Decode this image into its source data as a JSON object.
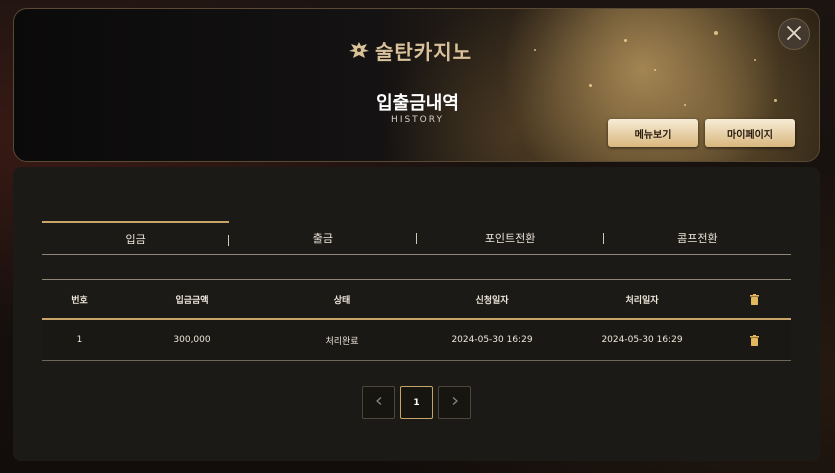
{
  "banner": {
    "logo_text": "술탄카지노",
    "title": "입출금내역",
    "subtitle": "HISTORY",
    "menu_button": "메뉴보기",
    "mypage_button": "마이페이지"
  },
  "icons": {
    "logo": "eagle-emblem-icon",
    "close": "close-icon",
    "delete": "trash-icon",
    "prev": "chevron-left-icon",
    "next": "chevron-right-icon"
  },
  "colors": {
    "accent_gold": "#c9a46a",
    "trash_gold": "#e2b85c",
    "panel_bg": "#1c1a16"
  },
  "tabs": [
    {
      "label": "입금",
      "active": true
    },
    {
      "label": "출금",
      "active": false
    },
    {
      "label": "포인트전환",
      "active": false
    },
    {
      "label": "콤프전환",
      "active": false
    }
  ],
  "table": {
    "headers": {
      "no": "번호",
      "amount": "입금금액",
      "status": "상태",
      "requested": "신청일자",
      "processed": "처리일자"
    },
    "rows": [
      {
        "no": "1",
        "amount": "300,000",
        "status": "처리완료",
        "requested": "2024-05-30 16:29",
        "processed": "2024-05-30 16:29"
      }
    ]
  },
  "pagination": {
    "current": "1"
  }
}
